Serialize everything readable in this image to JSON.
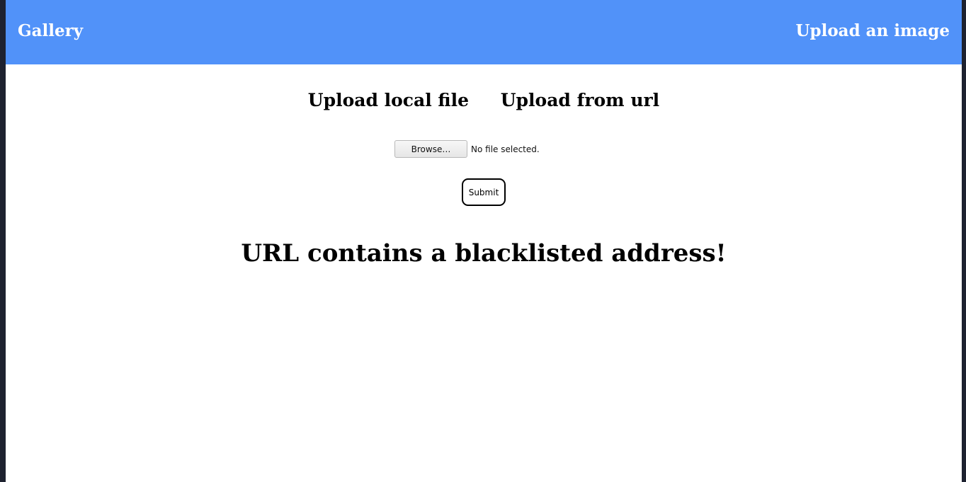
{
  "header": {
    "brand": "Gallery",
    "upload_link": "Upload an image"
  },
  "tabs": [
    {
      "label": "Upload local file"
    },
    {
      "label": "Upload from url"
    }
  ],
  "file_input": {
    "button_label": "Browse…",
    "status": "No file selected."
  },
  "submit_label": "Submit",
  "message": "URL contains a blacklisted address!",
  "colors": {
    "navbar": "#5192f9",
    "nav_text": "#ffffff",
    "background": "#ffffff",
    "page_edge": "#1e2230"
  }
}
